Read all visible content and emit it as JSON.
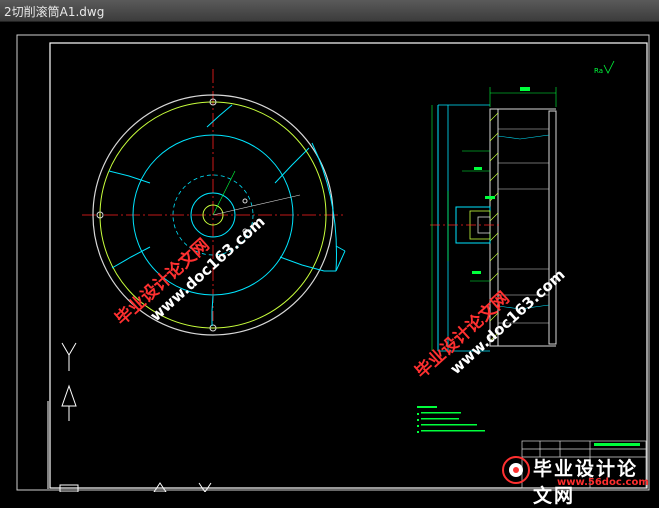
{
  "window": {
    "title": "2切削滚筒A1.dwg"
  },
  "watermarks": {
    "line1": "毕业设计论文网",
    "line2": "www.doc163.com"
  },
  "badge": {
    "main": "毕业设计论文网",
    "url": "www.56doc.com"
  },
  "colors": {
    "background": "#000000",
    "frame": "#ffffff",
    "outline": "#00e5ff",
    "ring": "#c8ff3c",
    "centerline": "#ff2020",
    "dimension": "#00ff3c",
    "watermark_cn": "#ff3030",
    "watermark_url": "#ffffff"
  }
}
